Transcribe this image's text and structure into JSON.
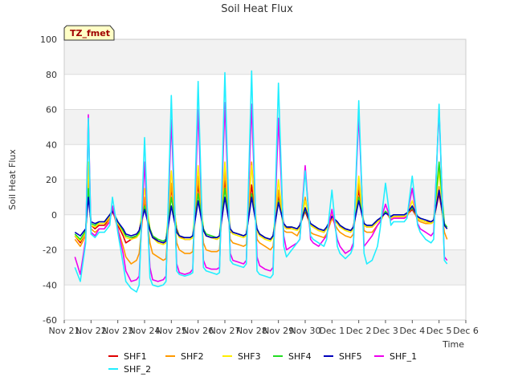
{
  "chart_data": {
    "type": "line",
    "title": "Soil Heat Flux",
    "xlabel": "Time",
    "ylabel": "Soil Heat Flux",
    "badge": "TZ_fmet",
    "xlim": [
      0,
      15
    ],
    "ylim": [
      -60,
      100
    ],
    "yticks": [
      -60,
      -40,
      -20,
      0,
      20,
      40,
      60,
      80,
      100
    ],
    "xticks": [
      {
        "x": 0,
        "label": "Nov 21"
      },
      {
        "x": 1,
        "label": "Nov 22"
      },
      {
        "x": 2,
        "label": "Nov 23"
      },
      {
        "x": 3,
        "label": "Nov 24"
      },
      {
        "x": 4,
        "label": "Nov 25"
      },
      {
        "x": 5,
        "label": "Nov 26"
      },
      {
        "x": 6,
        "label": "Nov 27"
      },
      {
        "x": 7,
        "label": "Nov 28"
      },
      {
        "x": 8,
        "label": "Nov 29"
      },
      {
        "x": 9,
        "label": "Nov 30"
      },
      {
        "x": 10,
        "label": "Dec 1"
      },
      {
        "x": 11,
        "label": "Dec 2"
      },
      {
        "x": 12,
        "label": "Dec 3"
      },
      {
        "x": 13,
        "label": "Dec 4"
      },
      {
        "x": 14,
        "label": "Dec 5"
      },
      {
        "x": 15,
        "label": "Dec 6"
      }
    ],
    "grid": true,
    "legend_position": "bottom",
    "x": [
      0.4,
      0.6,
      0.8,
      0.9,
      1.0,
      1.15,
      1.3,
      1.5,
      1.7,
      1.8,
      2.0,
      2.2,
      2.3,
      2.5,
      2.7,
      2.8,
      3.0,
      3.2,
      3.3,
      3.5,
      3.7,
      3.8,
      4.0,
      4.2,
      4.3,
      4.5,
      4.7,
      4.8,
      5.0,
      5.2,
      5.3,
      5.5,
      5.7,
      5.8,
      6.0,
      6.2,
      6.3,
      6.5,
      6.7,
      6.8,
      7.0,
      7.2,
      7.3,
      7.5,
      7.7,
      7.8,
      8.0,
      8.2,
      8.3,
      8.5,
      8.7,
      8.8,
      9.0,
      9.2,
      9.3,
      9.5,
      9.7,
      9.8,
      10.0,
      10.2,
      10.3,
      10.5,
      10.7,
      10.8,
      11.0,
      11.2,
      11.3,
      11.5,
      11.7,
      11.8,
      12.0,
      12.2,
      12.3,
      12.5,
      12.7,
      12.8,
      13.0,
      13.2,
      13.3,
      13.5,
      13.7,
      13.8,
      14.0,
      14.2,
      14.3
    ],
    "series": [
      {
        "name": "SHF1",
        "color": "#e00000",
        "values": [
          -12,
          -16,
          -10,
          25,
          -6,
          -8,
          -6,
          -6,
          -2,
          2,
          -6,
          -12,
          -16,
          -14,
          -12,
          -9,
          6,
          -8,
          -12,
          -15,
          -16,
          -15,
          15,
          -8,
          -12,
          -14,
          -14,
          -13,
          17,
          -8,
          -12,
          -13,
          -14,
          -13,
          20,
          -10,
          -10,
          -11,
          -12,
          -11,
          17,
          -9,
          -11,
          -13,
          -14,
          -12,
          10,
          -6,
          -8,
          -7,
          -8,
          -6,
          2,
          -6,
          -7,
          -9,
          -10,
          -8,
          -2,
          -5,
          -7,
          -8,
          -9,
          -7,
          14,
          -6,
          -7,
          -7,
          -4,
          -3,
          2,
          -2,
          -1,
          -1,
          -1,
          0,
          3,
          -2,
          -3,
          -4,
          -4,
          -3,
          12,
          -6,
          -8
        ]
      },
      {
        "name": "SHF2",
        "color": "#ff9900",
        "values": [
          -14,
          -18,
          -12,
          20,
          -8,
          -10,
          -8,
          -8,
          -2,
          3,
          -8,
          -18,
          -24,
          -28,
          -26,
          -22,
          10,
          -16,
          -22,
          -24,
          -26,
          -25,
          18,
          -16,
          -20,
          -22,
          -22,
          -21,
          22,
          -16,
          -20,
          -21,
          -21,
          -20,
          25,
          -14,
          -16,
          -17,
          -18,
          -17,
          30,
          -14,
          -16,
          -18,
          -20,
          -18,
          14,
          -9,
          -10,
          -10,
          -12,
          -9,
          10,
          -10,
          -11,
          -12,
          -13,
          -11,
          -2,
          -8,
          -10,
          -12,
          -13,
          -11,
          18,
          -9,
          -10,
          -10,
          -6,
          -4,
          2,
          -3,
          -2,
          -2,
          -2,
          -1,
          5,
          -3,
          -4,
          -5,
          -5,
          -4,
          16,
          -10,
          -14
        ]
      },
      {
        "name": "SHF3",
        "color": "#ffee00",
        "values": [
          -12,
          -15,
          -10,
          30,
          -6,
          -7,
          -5,
          -5,
          -1,
          3,
          -5,
          -10,
          -13,
          -14,
          -13,
          -11,
          15,
          -8,
          -13,
          -16,
          -17,
          -16,
          25,
          -10,
          -13,
          -14,
          -14,
          -13,
          28,
          -9,
          -12,
          -13,
          -14,
          -13,
          30,
          -9,
          -11,
          -12,
          -13,
          -12,
          28,
          -9,
          -12,
          -14,
          -15,
          -13,
          20,
          -6,
          -8,
          -8,
          -9,
          -7,
          8,
          -6,
          -7,
          -9,
          -10,
          -8,
          0,
          -5,
          -7,
          -9,
          -10,
          -8,
          22,
          -6,
          -7,
          -7,
          -4,
          -3,
          2,
          -2,
          -1,
          -1,
          -1,
          0,
          8,
          -2,
          -3,
          -4,
          -5,
          -4,
          25,
          -6,
          -8
        ]
      },
      {
        "name": "SHF4",
        "color": "#22dd22",
        "values": [
          -11,
          -14,
          -9,
          15,
          -5,
          -6,
          -4,
          -4,
          0,
          3,
          -4,
          -9,
          -12,
          -13,
          -12,
          -10,
          5,
          -8,
          -12,
          -14,
          -15,
          -14,
          10,
          -9,
          -12,
          -13,
          -13,
          -12,
          12,
          -8,
          -11,
          -12,
          -13,
          -12,
          15,
          -8,
          -10,
          -11,
          -12,
          -11,
          12,
          -8,
          -11,
          -13,
          -14,
          -12,
          8,
          -5,
          -7,
          -7,
          -8,
          -6,
          3,
          -5,
          -6,
          -8,
          -9,
          -7,
          -1,
          -4,
          -6,
          -8,
          -9,
          -7,
          10,
          -5,
          -6,
          -6,
          -3,
          -2,
          2,
          -1,
          0,
          0,
          0,
          1,
          4,
          -1,
          -2,
          -3,
          -4,
          -3,
          30,
          -5,
          -7
        ]
      },
      {
        "name": "SHF5",
        "color": "#0000bb",
        "values": [
          -10,
          -12,
          -8,
          10,
          -4,
          -5,
          -4,
          -4,
          0,
          2,
          -4,
          -8,
          -11,
          -12,
          -11,
          -9,
          3,
          -9,
          -13,
          -15,
          -16,
          -15,
          5,
          -10,
          -12,
          -13,
          -13,
          -12,
          8,
          -9,
          -12,
          -13,
          -13,
          -12,
          10,
          -8,
          -10,
          -11,
          -12,
          -11,
          10,
          -8,
          -11,
          -13,
          -14,
          -12,
          7,
          -5,
          -7,
          -7,
          -8,
          -6,
          4,
          -5,
          -6,
          -8,
          -9,
          -7,
          -1,
          -4,
          -6,
          -8,
          -9,
          -7,
          8,
          -5,
          -6,
          -6,
          -3,
          -2,
          1,
          -1,
          0,
          0,
          0,
          1,
          5,
          -1,
          -2,
          -3,
          -4,
          -3,
          14,
          -6,
          -8
        ]
      },
      {
        "name": "SHF_1",
        "color": "#ee00ee",
        "values": [
          -24,
          -34,
          -14,
          57,
          -10,
          -12,
          -8,
          -8,
          -4,
          5,
          -8,
          -22,
          -32,
          -38,
          -37,
          -35,
          30,
          -30,
          -37,
          -38,
          -37,
          -35,
          54,
          -28,
          -33,
          -34,
          -33,
          -31,
          60,
          -26,
          -30,
          -31,
          -31,
          -30,
          64,
          -22,
          -26,
          -27,
          -28,
          -26,
          63,
          -24,
          -29,
          -31,
          -32,
          -30,
          55,
          -12,
          -20,
          -18,
          -16,
          -14,
          28,
          -14,
          -16,
          -18,
          -14,
          -12,
          3,
          -14,
          -18,
          -22,
          -20,
          -16,
          57,
          -18,
          -16,
          -12,
          -6,
          -4,
          6,
          -3,
          -2,
          -2,
          -2,
          -1,
          15,
          -5,
          -8,
          -10,
          -12,
          -10,
          60,
          -24,
          -26
        ]
      },
      {
        "name": "SHF_2",
        "color": "#22eeff",
        "values": [
          -30,
          -38,
          -16,
          55,
          -11,
          -13,
          -10,
          -10,
          -6,
          10,
          -10,
          -28,
          -38,
          -42,
          -44,
          -40,
          44,
          -36,
          -40,
          -41,
          -40,
          -38,
          68,
          -32,
          -34,
          -35,
          -34,
          -33,
          76,
          -30,
          -32,
          -33,
          -34,
          -33,
          81,
          -26,
          -28,
          -29,
          -30,
          -28,
          82,
          -32,
          -34,
          -35,
          -36,
          -34,
          75,
          -18,
          -24,
          -20,
          -16,
          -14,
          25,
          -12,
          -14,
          -16,
          -18,
          -14,
          14,
          -18,
          -22,
          -25,
          -22,
          -18,
          65,
          -22,
          -28,
          -26,
          -18,
          -8,
          18,
          -6,
          -4,
          -4,
          -4,
          -2,
          22,
          -6,
          -10,
          -14,
          -16,
          -14,
          63,
          -26,
          -28
        ]
      }
    ]
  }
}
